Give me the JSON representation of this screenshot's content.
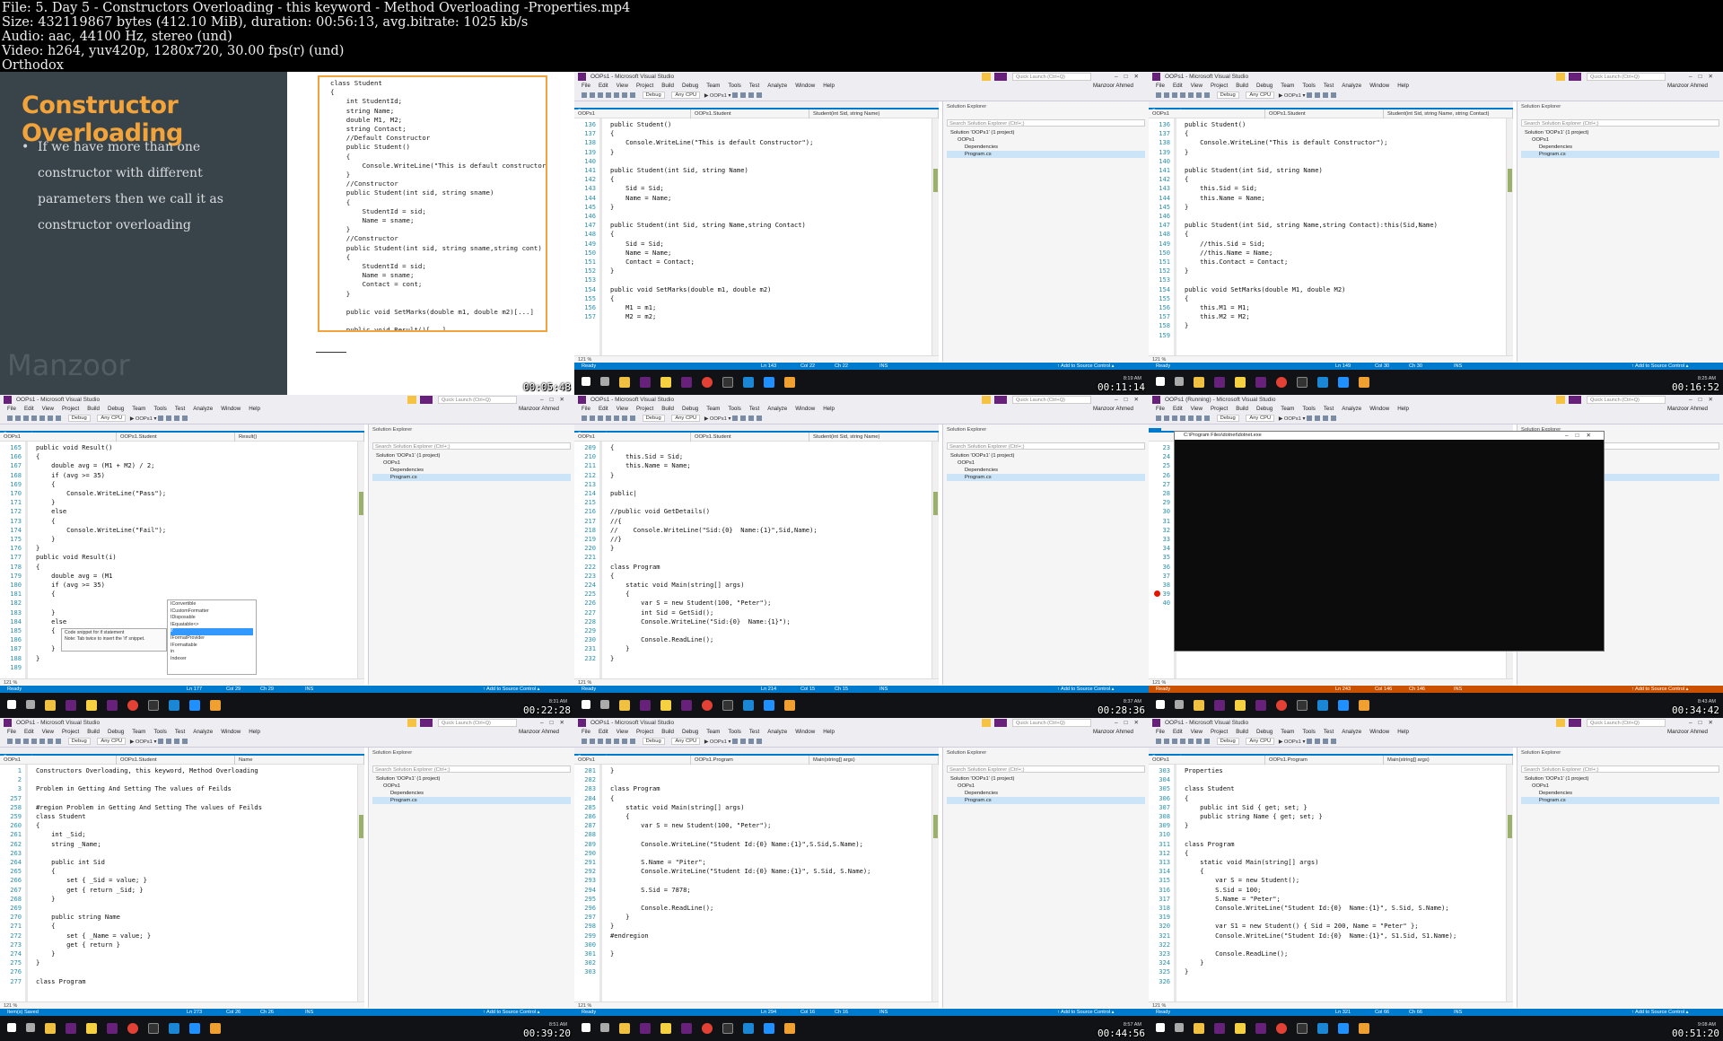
{
  "file_info": {
    "line1": "File: 5. Day 5 - Constructors Overloading - this keyword - Method Overloading -Properties.mp4",
    "line2": "Size: 432119867 bytes (412.10 MiB), duration: 00:56:13, avg.bitrate: 1025 kb/s",
    "line3": "Audio: aac, 44100 Hz, stereo (und)",
    "line4": "Video: h264, yuv420p, 1280x720, 30.00 fps(r) (und)",
    "line5": "Orthodox"
  },
  "cells": {
    "c1": {
      "timestamp": "00:05:48",
      "slide_title": "Constructor Overloading",
      "slide_bullet": "If we have more than one constructor with different parameters then we call it as constructor overloading",
      "watermark": "Manzoor",
      "code": "class Student\n{\n    int StudentId;\n    string Name;\n    double M1, M2;\n    string Contact;\n    //Default Constructor\n    public Student()\n    {\n        Console.WriteLine(\"This is default constructor\");\n    }\n    //Constructor\n    public Student(int sid, string sname)\n    {\n        StudentId = sid;\n        Name = sname;\n    }\n    //Constructor\n    public Student(int sid, string sname,string cont)\n    {\n        StudentId = sid;\n        Name = sname;\n        Contact = cont;\n    }\n\n    public void SetMarks(double m1, double m2)[...]\n\n    public void Result()[...]\n}"
    },
    "c2": {
      "timestamp": "00:11:14",
      "title": "OOPs1 - Microsoft Visual Studio",
      "tab": "Program.cs",
      "nav": [
        "OOPs1",
        "OOPs1.Student",
        "Student(int Sid, string Name)"
      ],
      "gutter": "136\n137\n138\n139\n140\n141\n142\n143\n144\n145\n146\n147\n148\n149\n150\n151\n152\n153\n154\n155\n156\n157",
      "code": "public Student()\n{\n    Console.WriteLine(\"This is default Constructor\");\n}\n\npublic Student(int Sid, string Name)\n{\n    Sid = Sid;\n    Name = Name;\n}\n\npublic Student(int Sid, string Name,string Contact)\n{\n    Sid = Sid;\n    Name = Name;\n    Contact = Contact;\n}\n\npublic void SetMarks(double m1, double m2)\n{\n    M1 = m1;\n    M2 = m2;",
      "zoom": "121 %",
      "status": {
        "left": "Ready",
        "ln": "Ln 143",
        "col": "Col 22",
        "ch": "Ch 22",
        "ins": "INS",
        "src": "↑ Add to Source Control ▴"
      },
      "clock": "8:19 AM"
    },
    "c3": {
      "timestamp": "00:16:52",
      "title": "OOPs1 - Microsoft Visual Studio",
      "tab": "Program.cs*",
      "nav": [
        "OOPs1",
        "OOPs1.Student",
        "Student(int Sid, string Name, string Contact)"
      ],
      "gutter": "136\n137\n138\n139\n140\n141\n142\n143\n144\n145\n146\n147\n148\n149\n150\n151\n152\n153\n154\n155\n156\n157\n158\n159",
      "code": "public Student()\n{\n    Console.WriteLine(\"This is default Constructor\");\n}\n\npublic Student(int Sid, string Name)\n{\n    this.Sid = Sid;\n    this.Name = Name;\n}\n\npublic Student(int Sid, string Name,string Contact):this(Sid,Name)\n{\n    //this.Sid = Sid;\n    //this.Name = Name;\n    this.Contact = Contact;\n}\n\npublic void SetMarks(double M1, double M2)\n{\n    this.M1 = M1;\n    this.M2 = M2;\n}",
      "zoom": "121 %",
      "status": {
        "left": "Ready",
        "ln": "Ln 149",
        "col": "Col 30",
        "ch": "Ch 30",
        "ins": "INS",
        "src": "↑ Add to Source Control ▴"
      },
      "clock": "8:25 AM"
    },
    "c4": {
      "timestamp": "00:22:28",
      "title": "OOPs1 - Microsoft Visual Studio",
      "tab": "Program.cs*",
      "nav": [
        "OOPs1",
        "OOPs1.Student",
        "Result()"
      ],
      "gutter": "165\n166\n167\n168\n169\n170\n171\n172\n173\n174\n175\n176\n177\n178\n179\n180\n181\n182\n183\n184\n185\n186\n187\n188\n189",
      "code": "public void Result()\n{\n    double avg = (M1 + M2) / 2;\n    if (avg >= 35)\n    {\n        Console.WriteLine(\"Pass\");\n    }\n    else\n    {\n        Console.WriteLine(\"Fail\");\n    }\n}\npublic void Result(i)\n{\n    double avg = (M1\n    if (avg >= 35)\n    {\n\n    }\n    else\n    {\n        Console.Wri\n    }\n}",
      "popup": [
        "IConvertible",
        "ICustomFormatter",
        "IDisposable",
        "IEquatable<>",
        "if",
        "IFormatProvider",
        "IFormattable",
        "in",
        "Indexer"
      ],
      "tip": "Code snippet for if statement\nNote: Tab twice to insert the 'if' snippet.",
      "zoom": "121 %",
      "status": {
        "left": "Ready",
        "ln": "Ln 177",
        "col": "Col 29",
        "ch": "Ch 29",
        "ins": "INS",
        "src": "↑ Add to Source Control ▴"
      },
      "clock": "8:31 AM"
    },
    "c5": {
      "timestamp": "00:28:36",
      "title": "OOPs1 - Microsoft Visual Studio",
      "tab": "Program.cs*",
      "nav": [
        "OOPs1",
        "OOPs1.Student",
        "Student(int Sid, string Name)"
      ],
      "gutter": "209\n210\n211\n212\n213\n214\n215\n216\n217\n218\n219\n220\n221\n222\n223\n224\n225\n226\n227\n228\n229\n230\n231\n232",
      "code": "{\n    this.Sid = Sid;\n    this.Name = Name;\n}\n\npublic|\n\n//public void GetDetails()\n//{\n//    Console.WriteLine(\"Sid:{0}  Name:{1}\",Sid,Name);\n//}\n}\n\nclass Program\n{\n    static void Main(string[] args)\n    {\n        var S = new Student(100, \"Peter\");\n        int Sid = GetSid();\n        Console.WriteLine(\"Sid:{0}  Name:{1}\");\n\n        Console.ReadLine();\n    }\n}",
      "zoom": "121 %",
      "status": {
        "left": "Ready",
        "ln": "Ln 214",
        "col": "Col 15",
        "ch": "Ch 15",
        "ins": "INS",
        "src": "↑ Add to Source Control ▴"
      },
      "clock": "8:37 AM"
    },
    "c6": {
      "timestamp": "00:34:42",
      "title": "OOPs1 (Running) - Microsoft Visual Studio",
      "console_title": "C:\\Program Files\\dotnet\\dotnet.exe",
      "gutter": "23\n24\n25\n26\n27\n28\n29\n30\n31\n32\n33\n34\n35\n36\n37\n38\n39\n40",
      "zoom": "121 %",
      "status": {
        "left": "Ready",
        "ln": "Ln 243",
        "col": "Col 146",
        "ch": "Ch 146",
        "ins": "INS",
        "src": "↑ Add to Source Control ▴"
      },
      "clock": "8:43 AM"
    },
    "c7": {
      "timestamp": "00:39:20",
      "title": "OOPs1 - Microsoft Visual Studio",
      "tab": "Program.cs*",
      "nav": [
        "OOPs1",
        "OOPs1.Student",
        "Name"
      ],
      "gutter": "1\n2\n3\n257\n258\n259\n260\n261\n262\n263\n264\n265\n266\n267\n268\n269\n270\n271\n272\n273\n274\n275\n276\n277",
      "code": "Constructors Overloading, this keyword, Method Overloading\n\nProblem in Getting And Setting The values of Feilds\n\n#region Problem in Getting And Setting The values of Feilds\nclass Student\n{\n    int _Sid;\n    string _Name;\n\n    public int Sid\n    {\n        set { _Sid = value; }\n        get { return _Sid; }\n    }\n\n    public string Name\n    {\n        set { _Name = value; }\n        get { return }\n    }\n}\n\nclass Program",
      "zoom": "121 %",
      "status": {
        "left": "Item(s) Saved",
        "ln": "Ln 273",
        "col": "Col 26",
        "ch": "Ch 26",
        "ins": "INS",
        "src": "↑ Add to Source Control ▴"
      },
      "clock": "8:51 AM"
    },
    "c8": {
      "timestamp": "00:44:56",
      "title": "OOPs1 - Microsoft Visual Studio",
      "tab": "Program.cs*",
      "nav": [
        "OOPs1",
        "OOPs1.Program",
        "Main(string[] args)"
      ],
      "gutter": "281\n282\n283\n284\n285\n286\n287\n288\n289\n290\n291\n292\n293\n294\n295\n296\n297\n298\n299\n300\n301\n302\n303",
      "code": "}\n\nclass Program\n{\n    static void Main(string[] args)\n    {\n        var S = new Student(100, \"Peter\");\n\n        Console.WriteLine(\"Student Id:{0} Name:{1}\",S.Sid,S.Name);\n\n        S.Name = \"Piter\";\n        Console.WriteLine(\"Student Id:{0} Name:{1}\", S.Sid, S.Name);\n\n        S.Sid = 7878;\n\n        Console.ReadLine();\n    }\n}\n#endregion\n\n}",
      "zoom": "121 %",
      "status": {
        "left": "Ready",
        "ln": "Ln 294",
        "col": "Col 16",
        "ch": "Ch 16",
        "ins": "INS",
        "src": "↑ Add to Source Control ▴"
      },
      "clock": "8:57 AM"
    },
    "c9": {
      "timestamp": "00:51:20",
      "title": "OOPs1 - Microsoft Visual Studio",
      "tab": "Program.cs*",
      "nav": [
        "OOPs1",
        "OOPs1.Program",
        "Main(string[] args)"
      ],
      "gutter": "303\n304\n305\n306\n307\n308\n309\n310\n311\n312\n313\n314\n315\n316\n317\n318\n319\n320\n321\n322\n323\n324\n325\n326",
      "code": "Properties\n\nclass Student\n{\n    public int Sid { get; set; }\n    public string Name { get; set; }\n}\n\nclass Program\n{\n    static void Main(string[] args)\n    {\n        var S = new Student();\n        S.Sid = 100;\n        S.Name = \"Peter\";\n        Console.WriteLine(\"Student Id:{0}  Name:{1}\", S.Sid, S.Name);\n\n        var S1 = new Student() { Sid = 200, Name = \"Peter\" };\n        Console.WriteLine(\"Student Id:{0}  Name:{1}\", S1.Sid, S1.Name);\n\n        Console.ReadLine();\n    }\n}",
      "zoom": "121 %",
      "status": {
        "left": "Ready",
        "ln": "Ln 321",
        "col": "Col 66",
        "ch": "Ch 66",
        "ins": "INS",
        "src": "↑ Add to Source Control ▴"
      },
      "clock": "9:08 AM"
    }
  },
  "vs": {
    "menu": [
      "File",
      "Edit",
      "View",
      "Project",
      "Build",
      "Debug",
      "Team",
      "Tools",
      "Test",
      "Analyze",
      "Window",
      "Help"
    ],
    "user": "Manzoor Ahmed",
    "quick_launch": "Quick Launch (Ctrl+Q)",
    "toolbar_config": "Debug",
    "toolbar_platform": "Any CPU",
    "toolbar_run": "▶ OOPs1 ▾",
    "se_title": "Solution Explorer",
    "se_search": "Search Solution Explorer (Ctrl+;)",
    "se_solution": "Solution 'OOPs1' (1 project)",
    "se_project": "OOPs1",
    "se_dep": "Dependencies",
    "se_file": "Program.cs"
  },
  "colors": {
    "accent": "#007acc",
    "slide_title": "#f2a33a",
    "slide_bg": "#39434a",
    "status_debug": "#ca5100"
  }
}
